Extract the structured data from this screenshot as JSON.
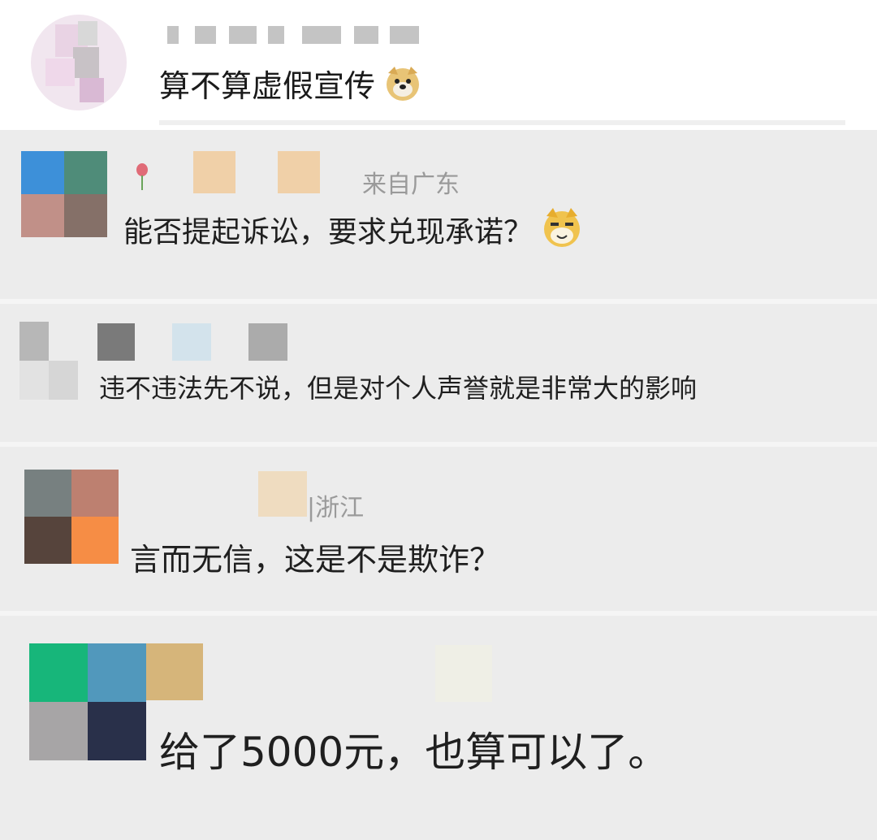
{
  "top_post": {
    "comment": "算不算虚假宣传",
    "emoji_icon": "doge-icon"
  },
  "comments": [
    {
      "location": "来自广东",
      "text": "能否提起诉讼，要求兑现承诺？",
      "emoji_icon": "doge-cat-icon"
    },
    {
      "text": "违不违法先不说，但是对个人声誉就是非常大的影响"
    },
    {
      "location": "浙江",
      "text": "言而无信，这是不是欺诈？"
    },
    {
      "text": "给了5000元，也算可以了。"
    }
  ],
  "colors": {
    "background": "#ececec",
    "top_background": "#ffffff",
    "meta_text": "#9a9a9a"
  }
}
